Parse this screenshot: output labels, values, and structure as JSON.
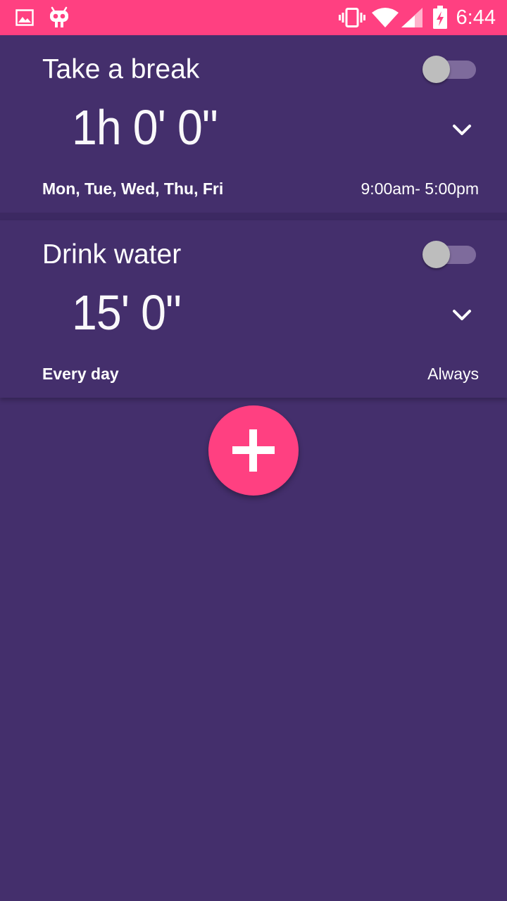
{
  "status_bar": {
    "time": "6:44",
    "icons": [
      "image-icon",
      "android-robot-icon",
      "vibrate-icon",
      "wifi-icon",
      "cell-signal-icon",
      "battery-charging-icon"
    ],
    "background_color": "#FF4081"
  },
  "reminders": [
    {
      "title": "Take a break",
      "duration": "1h 0' 0\"",
      "days": "Mon, Tue, Wed, Thu, Fri",
      "hours": "9:00am- 5:00pm",
      "enabled": false
    },
    {
      "title": "Drink water",
      "duration": "15' 0\"",
      "days": "Every day",
      "hours": "Always",
      "enabled": false
    }
  ],
  "fab": {
    "icon": "plus-icon",
    "color": "#FF4081"
  },
  "theme": {
    "background": "#442F6C",
    "accent": "#FF4081"
  }
}
